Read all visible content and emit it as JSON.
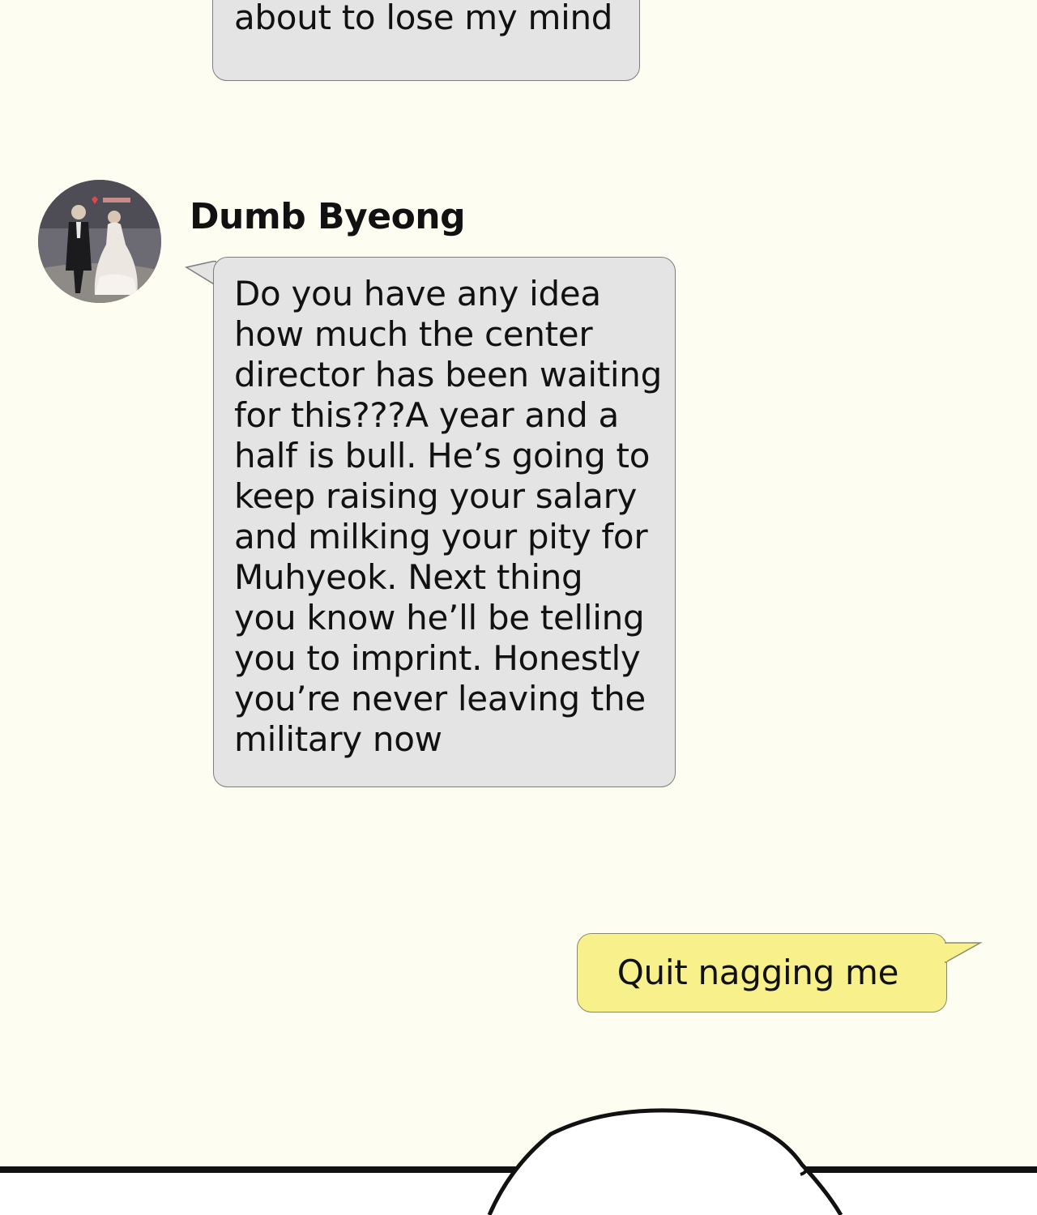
{
  "chat": {
    "previous_message": {
      "text": "about to lose my mind",
      "side": "incoming"
    },
    "incoming": {
      "sender_name": "Dumb Byeong",
      "avatar_icon": "wedding-couple-photo",
      "text": "Do you have any idea\nhow much the center\ndirector has been waiting\nfor this???A year and a\nhalf is bull. He’s going to\nkeep raising your salary\nand milking your pity for\nMuhyeok. Next thing\nyou know he’ll be telling\nyou to imprint. Honestly\nyou’re never leaving the\nmilitary now"
    },
    "outgoing": {
      "text": "Quit nagging me"
    }
  },
  "colors": {
    "background": "#fdfdf1",
    "incoming_bubble": "#e4e4e4",
    "outgoing_bubble": "#f7f08b",
    "bubble_border": "#7d7d7d",
    "panel_line": "#111111"
  }
}
